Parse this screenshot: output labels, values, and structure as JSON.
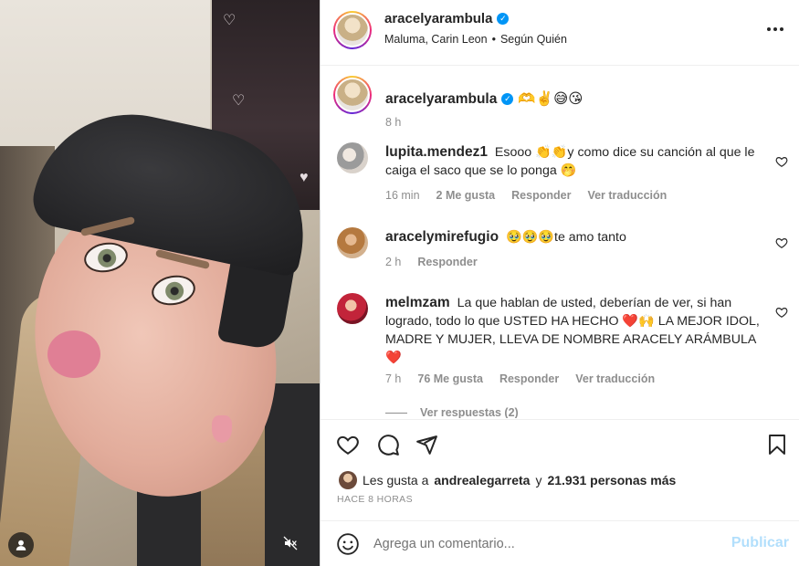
{
  "colors": {
    "verified": "#0095f6",
    "publish_disabled": "#b2dffc",
    "muted": "#8e8e8e",
    "heart_red": "#e0245e"
  },
  "header": {
    "username": "aracelyarambula",
    "audio_artists": "Maluma, Carin Leon",
    "separator": "•",
    "audio_source": "Según Quién"
  },
  "caption": {
    "username": "aracelyarambula",
    "text": "🫶✌️😅😘",
    "time": "8 h"
  },
  "comments": [
    {
      "username": "lupita.mendez1",
      "text": "Esooo 👏👏y como dice su canción al que le caiga el saco que se lo ponga 🤭",
      "time": "16 min",
      "likes": "2 Me gusta",
      "reply": "Responder",
      "translate": "Ver traducción"
    },
    {
      "username": "aracelymirefugio",
      "text": "🥹🥹🥹te amo tanto",
      "time": "2 h",
      "reply": "Responder"
    },
    {
      "username": "melmzam",
      "text": "La que hablan de usted, deberían de ver, si han logrado, todo lo que USTED HA HECHO ❤️🙌 LA MEJOR IDOL, MADRE Y MUJER, LLEVA DE NOMBRE ARACELY ARÁMBULA ❤️",
      "time": "7 h",
      "likes": "76 Me gusta",
      "reply": "Responder",
      "translate": "Ver traducción"
    }
  ],
  "view_replies": "Ver respuestas (2)",
  "likes": {
    "prefix": "Les gusta a",
    "user": "andrealegarreta",
    "connector": "y",
    "others": "21.931 personas más"
  },
  "posted": "HACE 8 HORAS",
  "add_comment": {
    "placeholder": "Agrega un comentario...",
    "publish": "Publicar"
  },
  "icons": {
    "more": "more-horizontal-icon",
    "like": "heart-outline-icon",
    "comment": "comment-bubble-icon",
    "share": "paper-plane-icon",
    "save": "bookmark-icon",
    "emoji": "smiley-icon",
    "mute": "muted-speaker-icon",
    "tagged_user": "user-icon"
  }
}
